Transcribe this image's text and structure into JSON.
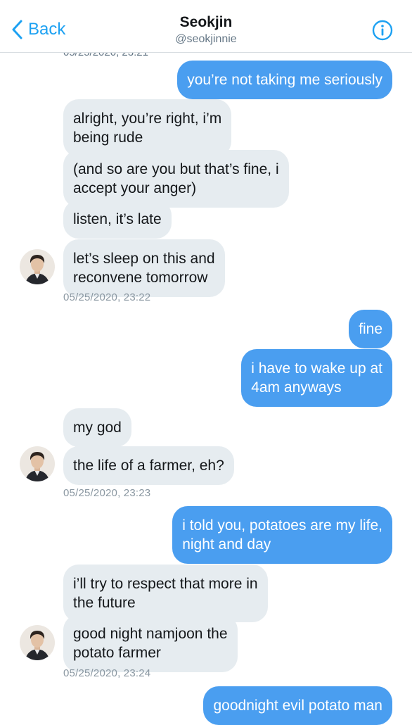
{
  "header": {
    "back_label": "Back",
    "title": "Seokjin",
    "handle": "@seokjinnie"
  },
  "top_cut_timestamp": "05/25/2020, 23:21",
  "messages": [
    {
      "dir": "out",
      "text": "you’re not taking me seriously"
    },
    {
      "dir": "in",
      "text": "alright, you’re right, i’m\nbeing rude"
    },
    {
      "dir": "in",
      "text": "(and so are you but that’s fine, i\naccept your anger)"
    },
    {
      "dir": "in",
      "text": "listen, it’s late"
    },
    {
      "dir": "in",
      "text": "let’s sleep on this and\nreconvene tomorrow"
    },
    {
      "dir": "out",
      "text": "fine"
    },
    {
      "dir": "out",
      "text": "i have to wake up at\n4am anyways"
    },
    {
      "dir": "in",
      "text": "my god"
    },
    {
      "dir": "in",
      "text": "the life of a farmer, eh?"
    },
    {
      "dir": "out",
      "text": "i told you, potatoes are my life,\nnight and day"
    },
    {
      "dir": "in",
      "text": "i’ll try to respect that more in\nthe future"
    },
    {
      "dir": "in",
      "text": "good night namjoon the\npotato farmer"
    },
    {
      "dir": "out",
      "text": "goodnight evil potato man"
    }
  ],
  "timestamps": [
    "05/25/2020, 23:22",
    "05/25/2020, 23:23",
    "05/25/2020, 23:24"
  ],
  "colors": {
    "accent": "#1da1f2",
    "outgoing_bubble": "#4a9ef0",
    "incoming_bubble": "#e6ecf0"
  },
  "icons": [
    "chevron-left-icon",
    "info-icon"
  ]
}
